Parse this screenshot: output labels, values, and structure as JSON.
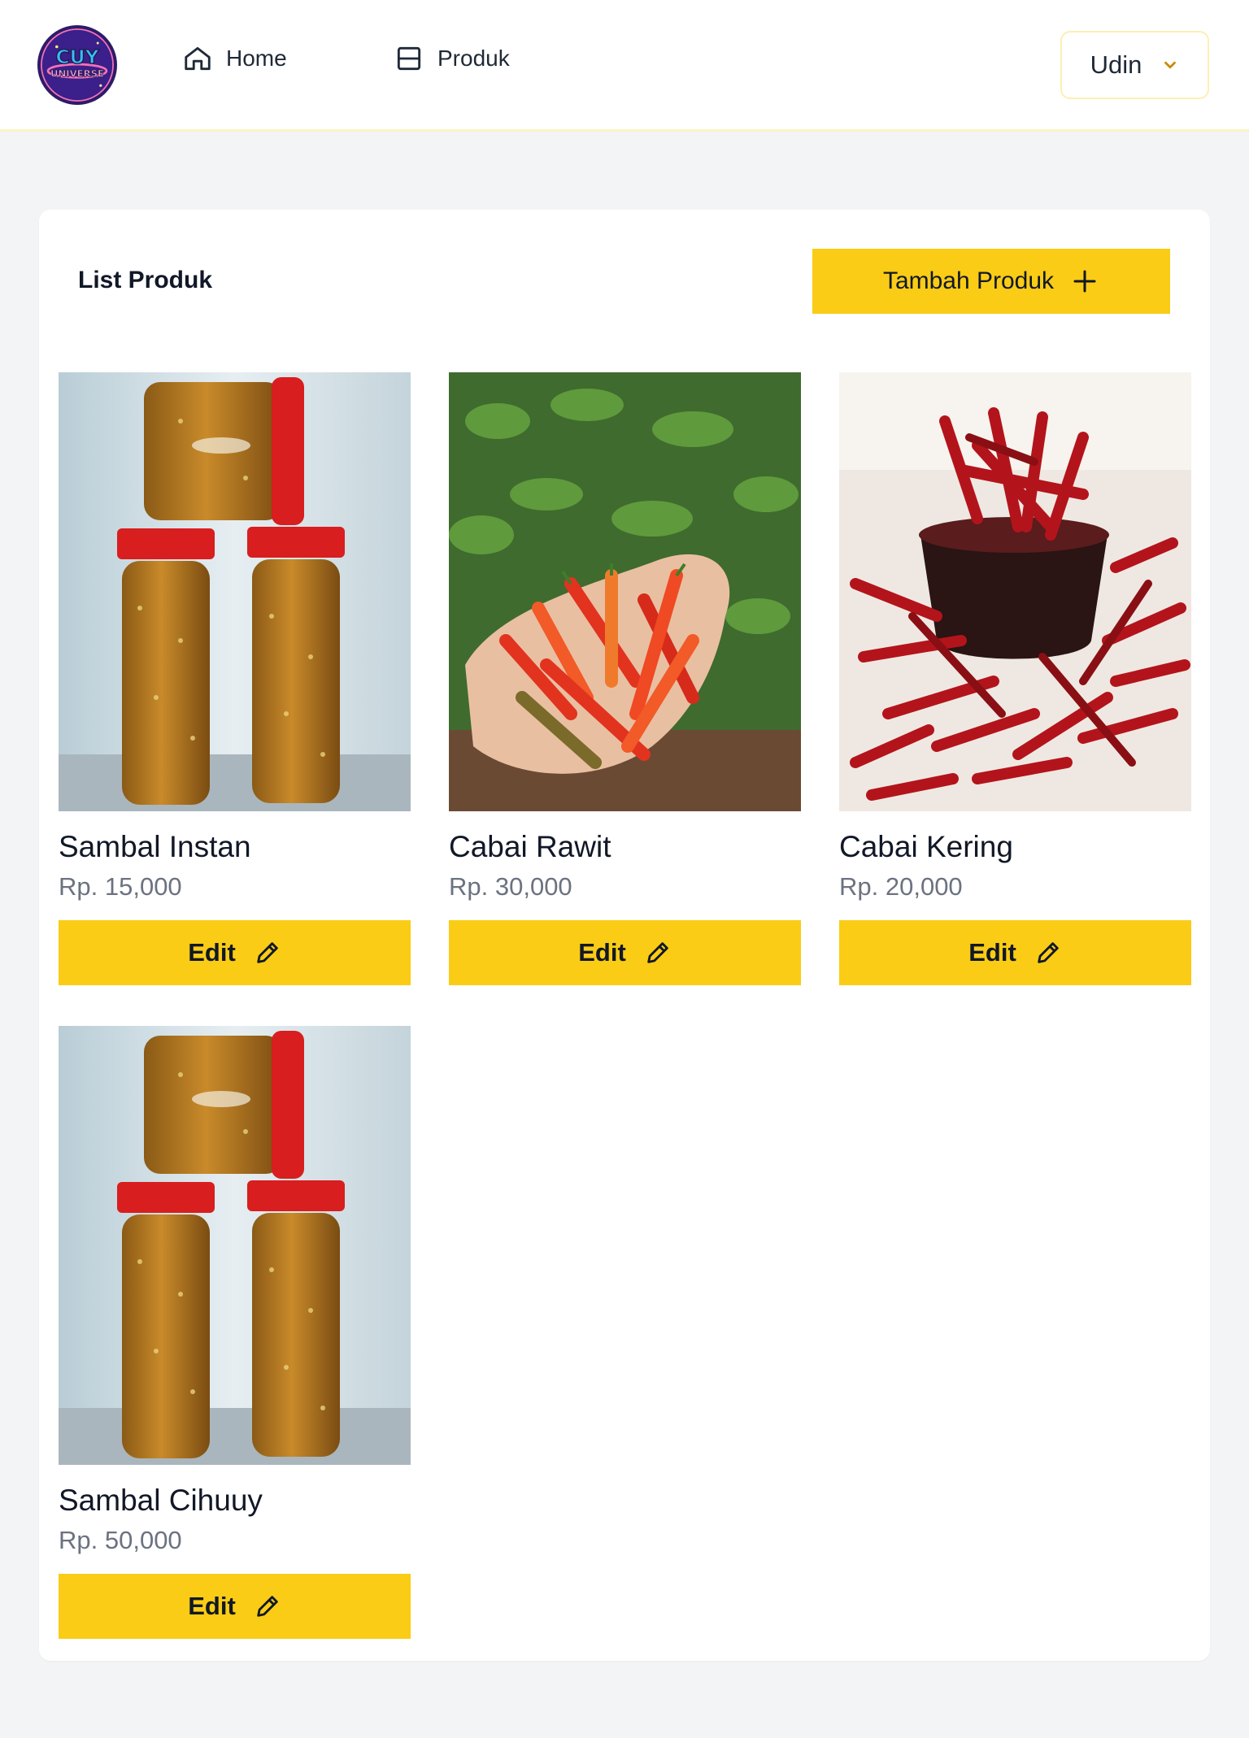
{
  "navbar": {
    "logo_text": "CUY UNIVERSE",
    "links": [
      {
        "label": "Home",
        "icon": "home-icon"
      },
      {
        "label": "Produk",
        "icon": "layout-icon"
      }
    ],
    "user": {
      "name": "Udin",
      "icon": "chevron-down-icon"
    }
  },
  "panel": {
    "title": "List Produk",
    "add_button": {
      "label": "Tambah Produk",
      "icon": "plus-icon"
    }
  },
  "products": [
    {
      "name": "Sambal Instan",
      "price": "Rp. 15,000",
      "image": "sambal-jars",
      "edit_label": "Edit",
      "edit_icon": "pencil-icon"
    },
    {
      "name": "Cabai Rawit",
      "price": "Rp. 30,000",
      "image": "chili-hand",
      "edit_label": "Edit",
      "edit_icon": "pencil-icon"
    },
    {
      "name": "Cabai Kering",
      "price": "Rp. 20,000",
      "image": "dried-chili-bowl",
      "edit_label": "Edit",
      "edit_icon": "pencil-icon"
    },
    {
      "name": "Sambal Cihuuy",
      "price": "Rp. 50,000",
      "image": "sambal-jars",
      "edit_label": "Edit",
      "edit_icon": "pencil-icon"
    }
  ],
  "colors": {
    "accent": "#facc15",
    "page_bg": "#f3f4f6",
    "price": "#6b7280"
  }
}
